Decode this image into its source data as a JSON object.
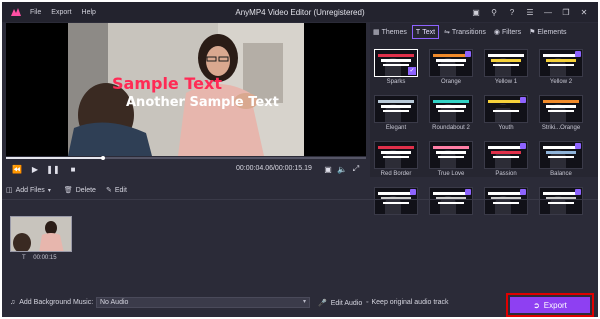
{
  "app": {
    "title": "AnyMP4 Video Editor (Unregistered)",
    "menu": [
      "File",
      "Export",
      "Help"
    ],
    "title_icons": [
      "save-icon",
      "cart-icon",
      "help-icon",
      "menu-icon",
      "minimize-icon",
      "restore-icon",
      "close-icon"
    ]
  },
  "preview": {
    "text_line_1": "Sample Text",
    "text_line_2": "Another Sample Text",
    "timecode": "00:00:04.06/00:00:15.19",
    "progress": 0.27
  },
  "panel": {
    "tabs": [
      {
        "label": "Themes",
        "icon": "themes-icon"
      },
      {
        "label": "Text",
        "icon": "text-icon",
        "active": true
      },
      {
        "label": "Transitions",
        "icon": "transitions-icon"
      },
      {
        "label": "Filters",
        "icon": "filters-icon"
      },
      {
        "label": "Elements",
        "icon": "elements-icon"
      }
    ],
    "templates": [
      {
        "label": "Sparks",
        "selected": true,
        "a": "#e0304a",
        "b": "#ffffff"
      },
      {
        "label": "Orange",
        "a": "#f08a2a",
        "b": "#ffffff"
      },
      {
        "label": "Yellow 1",
        "a": "#ffffff",
        "b": "#f6d23a"
      },
      {
        "label": "Yellow 2",
        "a": "#ffffff",
        "b": "#f6d23a"
      },
      {
        "label": "Elegant",
        "a": "#b8c9d8",
        "b": "#ffffff"
      },
      {
        "label": "Roundabout 2",
        "a": "#31d3c6",
        "b": "#ffffff"
      },
      {
        "label": "Youth",
        "a": "#f6d23a",
        "b": "#111111"
      },
      {
        "label": "Striki...Orange",
        "a": "#f08a2a",
        "b": "#ffffff"
      },
      {
        "label": "Red Border",
        "a": "#e0304a",
        "b": "#ffffff"
      },
      {
        "label": "True Love",
        "a": "#ff7fa6",
        "b": "#ffffff"
      },
      {
        "label": "Passion",
        "a": "#ffffff",
        "b": "#e0304a"
      },
      {
        "label": "Balance",
        "a": "#ffffff",
        "b": "#8fb3d9"
      },
      {
        "label": "",
        "a": "#ffffff",
        "b": "#cccccc"
      },
      {
        "label": "",
        "a": "#ffffff",
        "b": "#cccccc"
      },
      {
        "label": "",
        "a": "#ffffff",
        "b": "#cccccc"
      },
      {
        "label": "",
        "a": "#ffffff",
        "b": "#cccccc"
      }
    ]
  },
  "toolbar": {
    "add_files": "Add Files",
    "delete": "Delete",
    "edit": "Edit"
  },
  "timeline": {
    "clip_duration": "00:00:15",
    "clip_type": "T"
  },
  "bottom": {
    "bgm_label": "Add Background Music:",
    "audio_value": "No Audio",
    "edit_audio": "Edit Audio",
    "keep_original": "Keep original audio track",
    "export_label": "Export"
  },
  "colors": {
    "accent": "#8e40f2",
    "highlight": "#e00000",
    "tab_border": "#8e63ff"
  }
}
